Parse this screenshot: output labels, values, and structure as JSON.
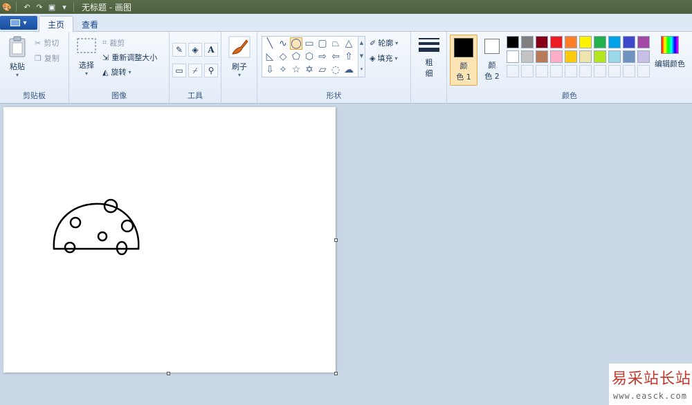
{
  "window": {
    "title": "无标题 - 画图"
  },
  "tabs": [
    {
      "label": "主页"
    },
    {
      "label": "查看"
    }
  ],
  "clipboard": {
    "label": "剪贴板",
    "paste": "粘贴",
    "cut": "剪切",
    "copy": "复制"
  },
  "image": {
    "label": "图像",
    "select": "选择",
    "crop": "裁剪",
    "resize": "重新调整大小",
    "rotate": "旋转"
  },
  "tools": {
    "label": "工具",
    "text_tool_glyph": "A"
  },
  "brushes": {
    "label": "刷子"
  },
  "shapes": {
    "label": "形状",
    "outline": "轮廓",
    "fill": "填充"
  },
  "size": {
    "line1": "粗",
    "line2": "细"
  },
  "colors": {
    "label": "颜色",
    "color1_line1": "颜",
    "color1_line2": "色 1",
    "color2_line1": "颜",
    "color2_line2": "色 2",
    "edit": "编辑颜色",
    "color1_value": "#000000",
    "color2_value": "#ffffff",
    "palette_row1": [
      "#000000",
      "#7f7f7f",
      "#880015",
      "#ed1c24",
      "#ff7f27",
      "#fff200",
      "#22b14c",
      "#00a2e8",
      "#3f48cc",
      "#a349a4"
    ],
    "palette_row2": [
      "#ffffff",
      "#c3c3c3",
      "#b97a57",
      "#ffaec9",
      "#ffc90e",
      "#efe4b0",
      "#b5e61d",
      "#99d9ea",
      "#7092be",
      "#c8bfe7"
    ]
  },
  "watermark": {
    "title": "易采站长站",
    "url": "www.easck.com"
  }
}
